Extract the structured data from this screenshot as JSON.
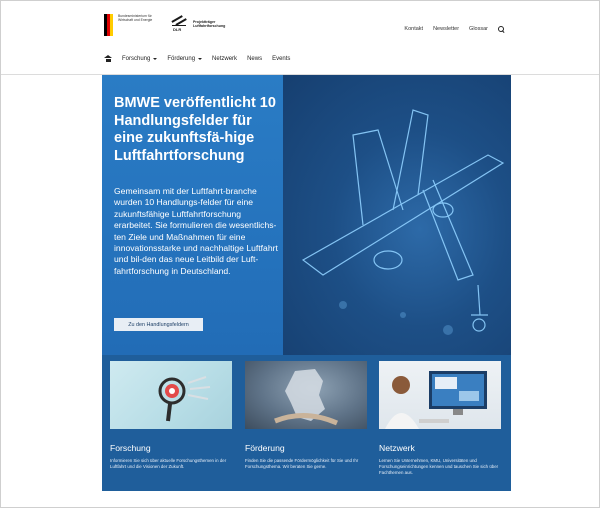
{
  "header": {
    "bmwe_logo_text": "Bundesministerium für Wirtschaft und Energie",
    "dlr_logo_text": "Projektträger Luftfahrtforschung",
    "dlr_mark_text": "DLR",
    "top_links": [
      "Kontakt",
      "Newsletter",
      "Glossar"
    ]
  },
  "nav": {
    "items": [
      {
        "label": "Forschung",
        "dropdown": true
      },
      {
        "label": "Förderung",
        "dropdown": true
      },
      {
        "label": "Netzwerk",
        "dropdown": false
      },
      {
        "label": "News",
        "dropdown": false
      },
      {
        "label": "Events",
        "dropdown": false
      }
    ]
  },
  "hero": {
    "title": "BMWE veröffentlicht 10 Handlungsfelder für eine zukunftsfä-hige Luftfahrtforschung",
    "body": "Gemeinsam mit der Luftfahrt-branche wurden 10 Handlungs-felder für eine zukunftsfähige Luftfahrtforschung erarbeitet. Sie formulieren die wesentlichs-ten Ziele und Maßnahmen für eine innovationsstarke und nachhaltige Luftfahrt und bil-den das neue Leitbild der Luft-fahrtforschung in Deutschland.",
    "button_label": "Zu den Handlungsfeldern"
  },
  "cards": [
    {
      "title": "Forschung",
      "text": "Informieren Sie sich über aktuelle Forschungsthemen in der Luftfahrt und die Visionen der Zukunft."
    },
    {
      "title": "Förderung",
      "text": "Finden Sie die passende Fördermöglichkeit für Sie und Ihr Forschungsthema. Wir beraten Sie gerne."
    },
    {
      "title": "Netzwerk",
      "text": "Lernen Sie Unternehmen, KMU, Universitäten und Forschungseinrichtungen kennen und tauschen Sie sich über Fachthemen aus."
    }
  ],
  "colors": {
    "hero_left": "#2573bd",
    "hero_right": "#1d4f86",
    "cards_bg": "#1f5e9b",
    "flag_black": "#000000",
    "flag_red": "#dd0000",
    "flag_gold": "#ffcc00"
  },
  "icons": [
    "home-icon",
    "search-icon",
    "chevron-down-icon"
  ]
}
